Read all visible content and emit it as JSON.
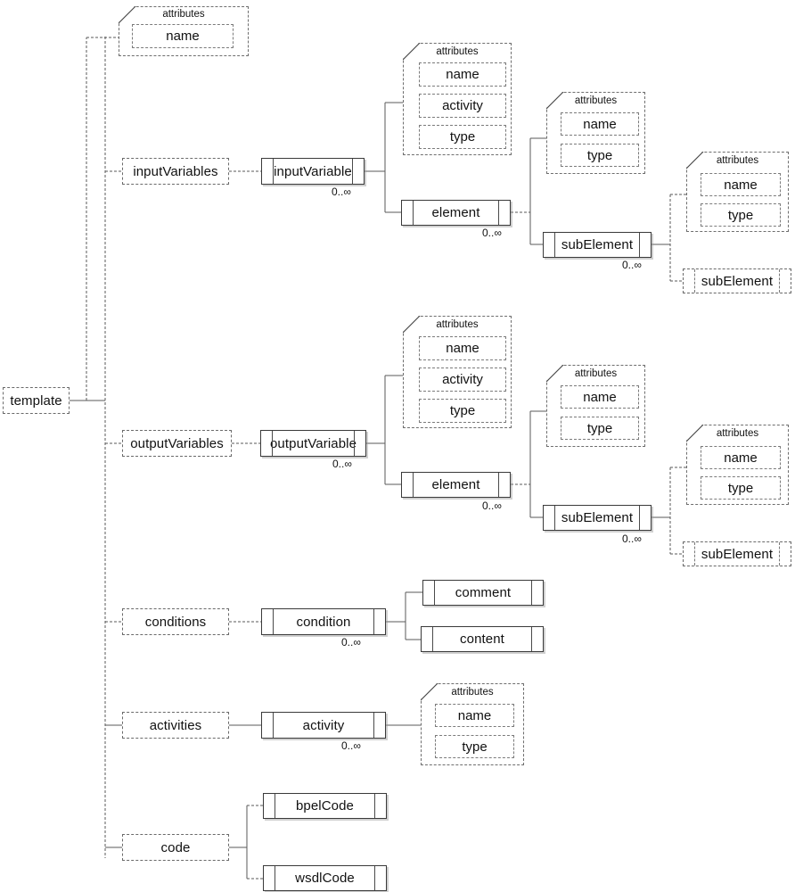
{
  "diagram": {
    "title": "template",
    "cardinality_symbol": "0..∞",
    "attributes_title": "attributes",
    "root": {
      "label": "template"
    },
    "branches": [
      {
        "label": "inputVariables"
      },
      {
        "label": "outputVariables"
      },
      {
        "label": "conditions"
      },
      {
        "label": "activities"
      },
      {
        "label": "code"
      }
    ],
    "nodes": {
      "root_attributes_title": "attributes",
      "root_attr_name": "name",
      "input_variables": "inputVariables",
      "input_variable": "inputVariable",
      "input_variable_card": "0..∞",
      "input_attr_title": "attributes",
      "input_attr_name": "name",
      "input_attr_activity": "activity",
      "input_attr_type": "type",
      "input_element": "element",
      "input_element_card": "0..∞",
      "input_element_attr_title": "attributes",
      "input_element_attr_name": "name",
      "input_element_attr_type": "type",
      "input_sub_element": "subElement",
      "input_sub_element_card": "0..∞",
      "input_sub_attr_title": "attributes",
      "input_sub_attr_name": "name",
      "input_sub_attr_type": "type",
      "input_sub_element_leaf": "subElement",
      "output_variables": "outputVariables",
      "output_variable": "outputVariable",
      "output_variable_card": "0..∞",
      "output_attr_title": "attributes",
      "output_attr_name": "name",
      "output_attr_activity": "activity",
      "output_attr_type": "type",
      "output_element": "element",
      "output_element_card": "0..∞",
      "output_element_attr_title": "attributes",
      "output_element_attr_name": "name",
      "output_element_attr_type": "type",
      "output_sub_element": "subElement",
      "output_sub_element_card": "0..∞",
      "output_sub_attr_title": "attributes",
      "output_sub_attr_name": "name",
      "output_sub_attr_type": "type",
      "output_sub_element_leaf": "subElement",
      "conditions": "conditions",
      "condition": "condition",
      "condition_card": "0..∞",
      "comment": "comment",
      "content": "content",
      "activities": "activities",
      "activity": "activity",
      "activity_card": "0..∞",
      "activity_attr_title": "attributes",
      "activity_attr_name": "name",
      "activity_attr_type": "type",
      "code": "code",
      "bpel_code": "bpelCode",
      "wsdl_code": "wsdlCode"
    },
    "colors": {
      "background": "#ffffff",
      "line": "#555555",
      "box_border": "#3a3a3a",
      "dashed_border": "#6e6e6e",
      "text": "#111111"
    }
  }
}
